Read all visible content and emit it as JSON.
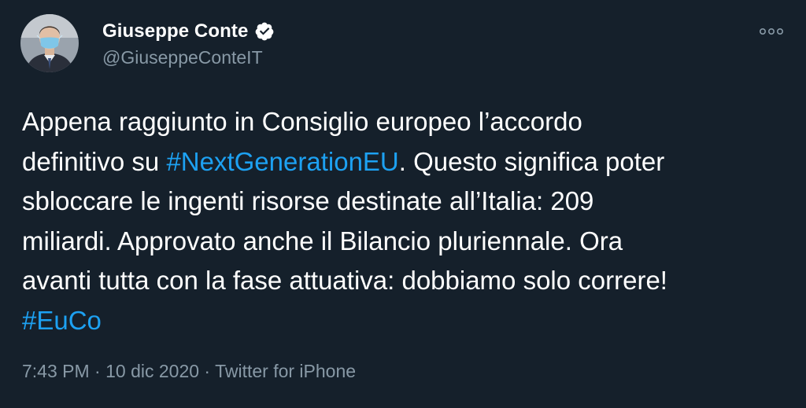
{
  "user": {
    "display_name": "Giuseppe Conte",
    "handle": "@GiuseppeConteIT",
    "verified": true,
    "avatar_icon": "profile-photo"
  },
  "more_icon": "more-options-icon",
  "tweet": {
    "line1": "Appena raggiunto in Consiglio europeo l’accordo",
    "line2_a": "definitivo su ",
    "hashtag1": "#NextGenerationEU",
    "line2_b": ". Questo significa poter",
    "line3": "sbloccare le ingenti risorse destinate all’Italia: 209",
    "line4": "miliardi. Approvato anche il Bilancio pluriennale. Ora",
    "line5": "avanti tutta con la fase attuativa: dobbiamo solo correre!",
    "hashtag2": "#EuCo"
  },
  "meta": {
    "time": "7:43 PM",
    "sep1": " · ",
    "date": "10 dic 2020",
    "sep2": " · ",
    "source": "Twitter for iPhone"
  },
  "colors": {
    "background": "#15202b",
    "text": "#ffffff",
    "secondary": "#8899a6",
    "link": "#1da1f2"
  }
}
